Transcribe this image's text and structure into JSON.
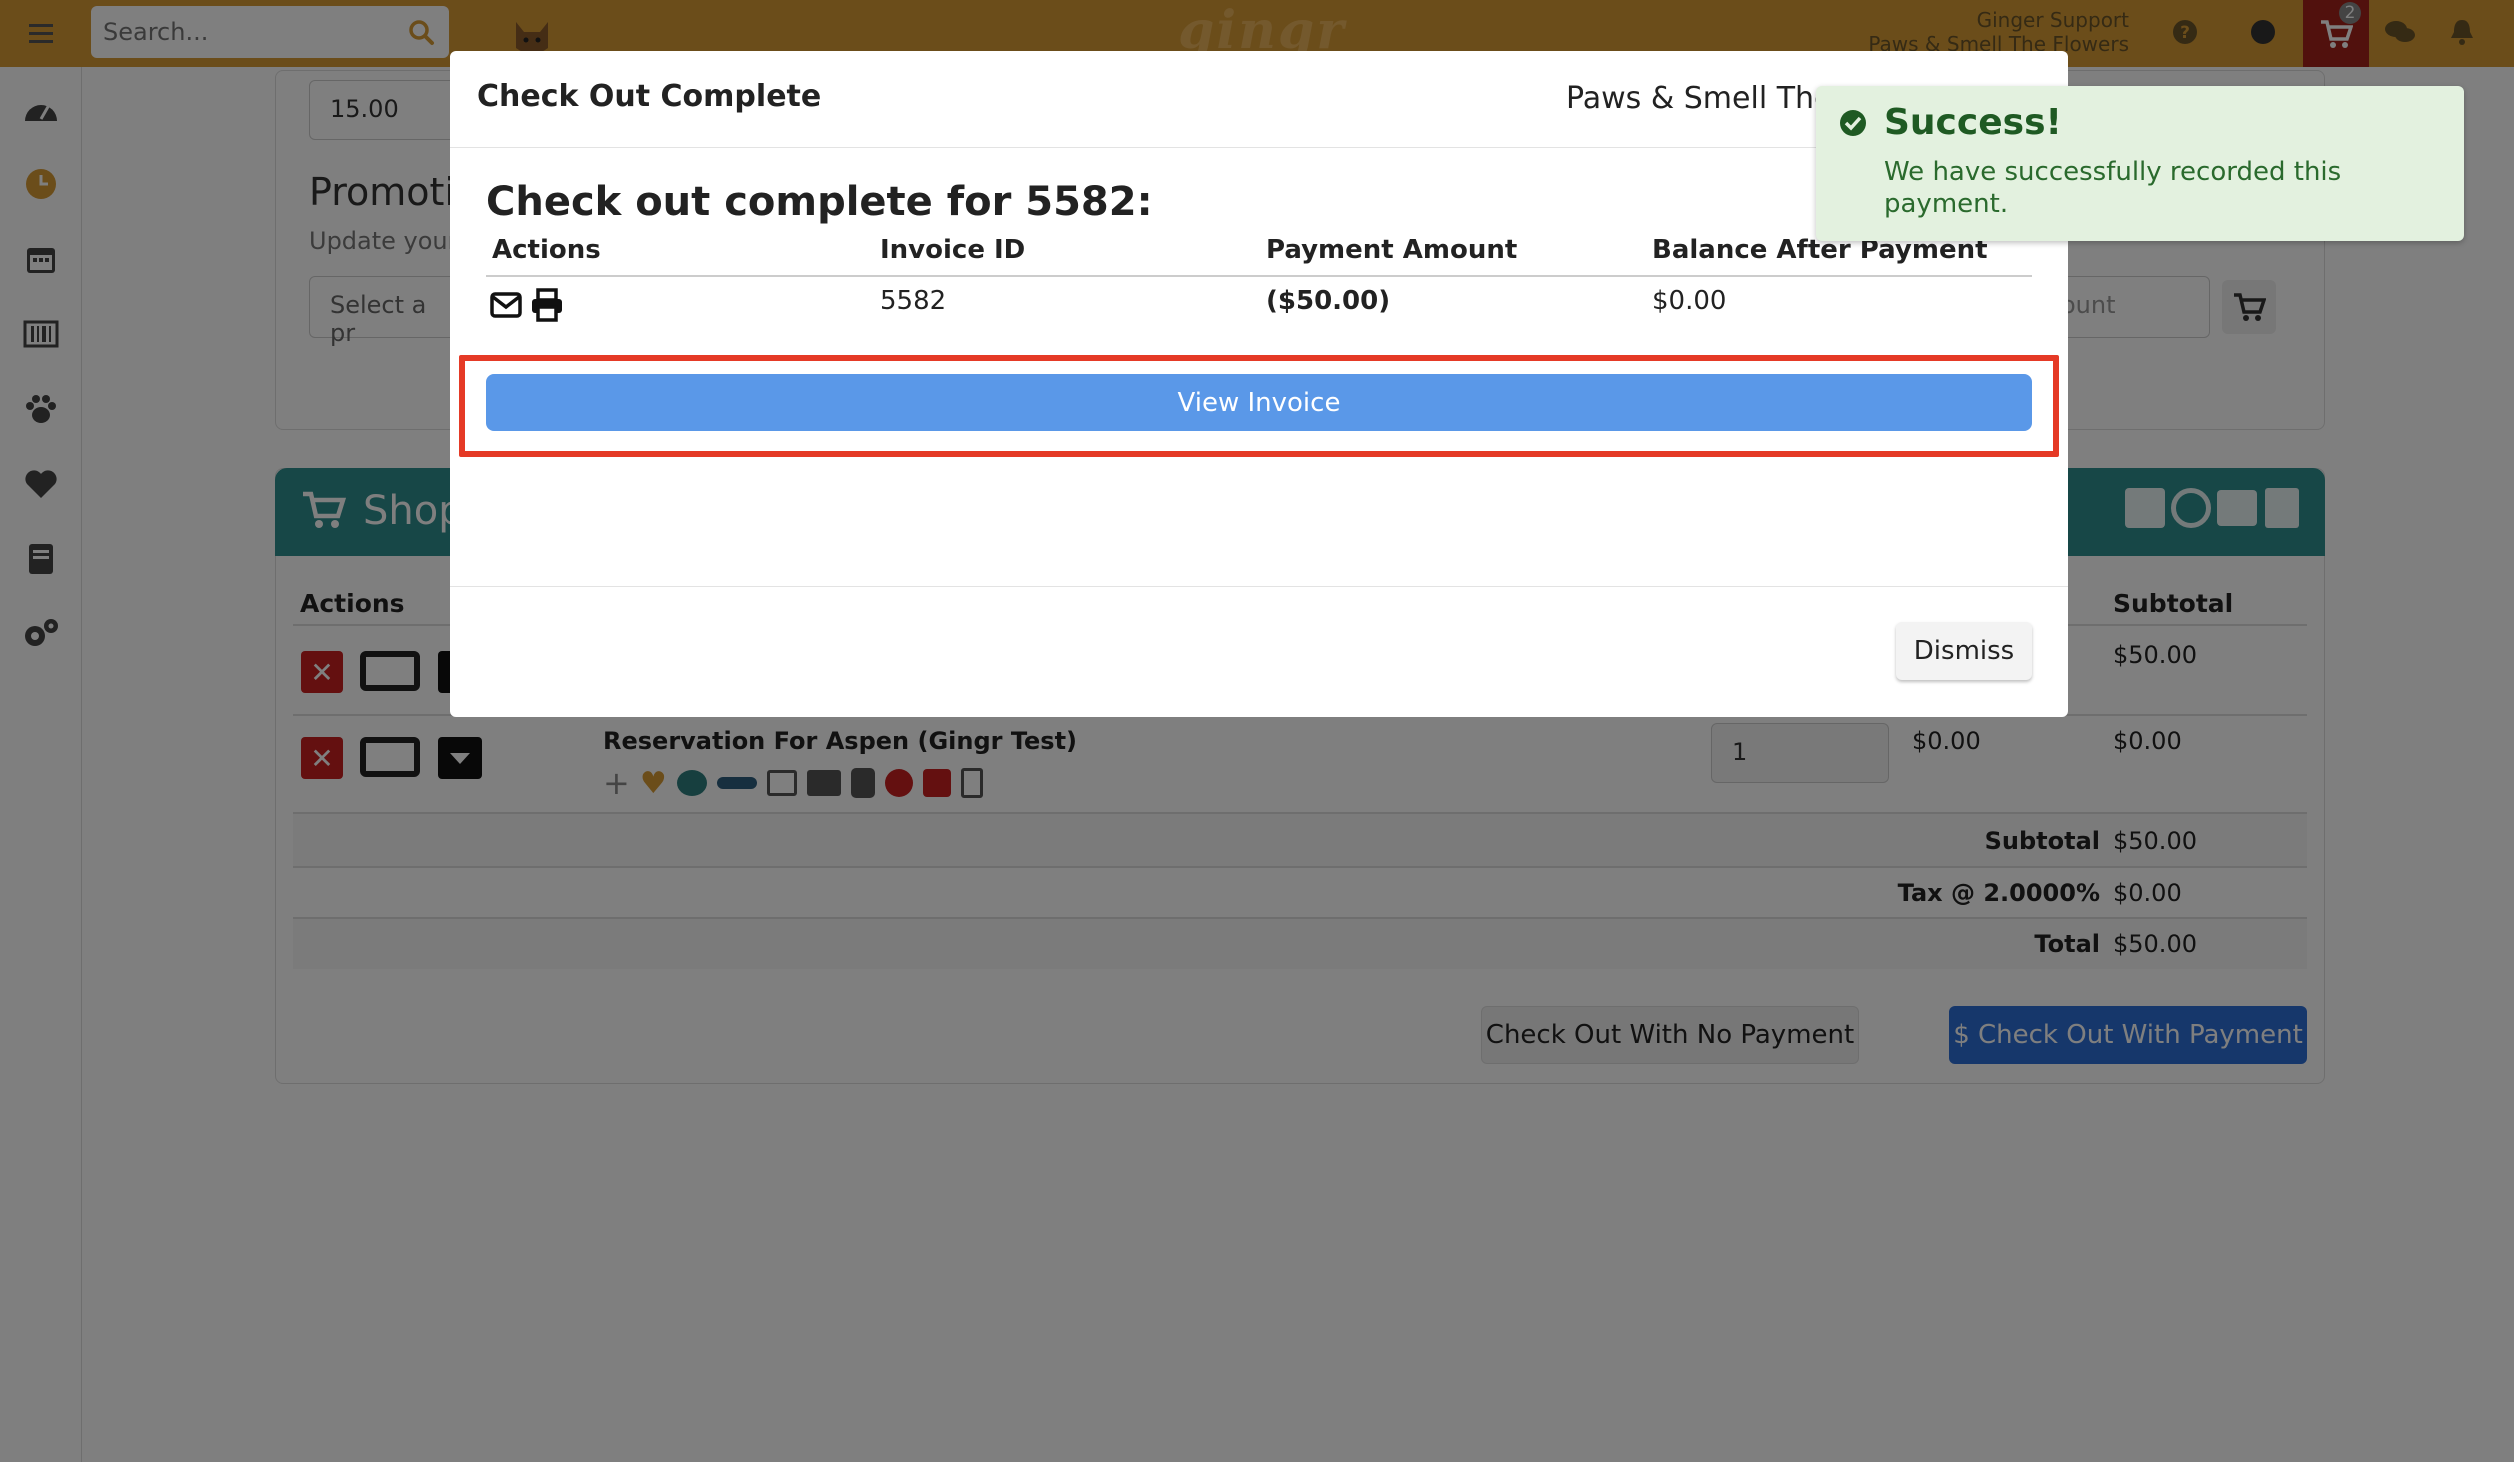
{
  "topbar": {
    "search_placeholder": "Search...",
    "logo": "gingr",
    "user_name": "Ginger Support",
    "location": "Paws & Smell The Flowers",
    "cart_count": "2"
  },
  "sidebar": {
    "items": [
      "dashboard-icon",
      "clock-icon",
      "calendar-icon",
      "barcode-icon",
      "paw-icon",
      "heart-icon",
      "book-icon",
      "cogs-icon"
    ]
  },
  "background": {
    "credit_field_value": "15.00",
    "promotion_heading": "Promoti",
    "promotion_sub": "Update your",
    "promotion_select": "Select a pr",
    "discount_placeholder": "ount",
    "shop_title": "Shop",
    "columns": {
      "actions": "Actions",
      "subtotal": "Subtotal"
    },
    "row1": {
      "subtotal": "$50.00"
    },
    "row2": {
      "name": "Reservation For Aspen (Gingr Test)",
      "qty": "1",
      "price": "$0.00",
      "subtotal": "$0.00"
    },
    "totals": {
      "subtotal_label": "Subtotal",
      "subtotal_value": "$50.00",
      "tax_label": "Tax @ 2.0000%",
      "tax_value": "$0.00",
      "total_label": "Total",
      "total_value": "$50.00"
    },
    "buttons": {
      "no_payment": "Check Out With No Payment",
      "with_payment": "$ Check Out With Payment"
    }
  },
  "modal": {
    "title": "Check Out Complete",
    "business": "Paws & Smell The F",
    "heading": "Check out complete for 5582:",
    "columns": [
      "Actions",
      "Invoice ID",
      "Payment Amount",
      "Balance After Payment"
    ],
    "row": {
      "invoice_id": "5582",
      "payment_amount": "($50.00)",
      "balance": "$0.00"
    },
    "view_invoice": "View Invoice",
    "dismiss": "Dismiss"
  },
  "toast": {
    "title": "Success!",
    "message": "We have successfully recorded this payment."
  },
  "colors": {
    "topbar": "#d69a34",
    "accent_blue": "#5a98e8",
    "highlight": "#e53a26",
    "toast_bg": "#e3f1df",
    "shop_header": "#2f8f8f"
  }
}
